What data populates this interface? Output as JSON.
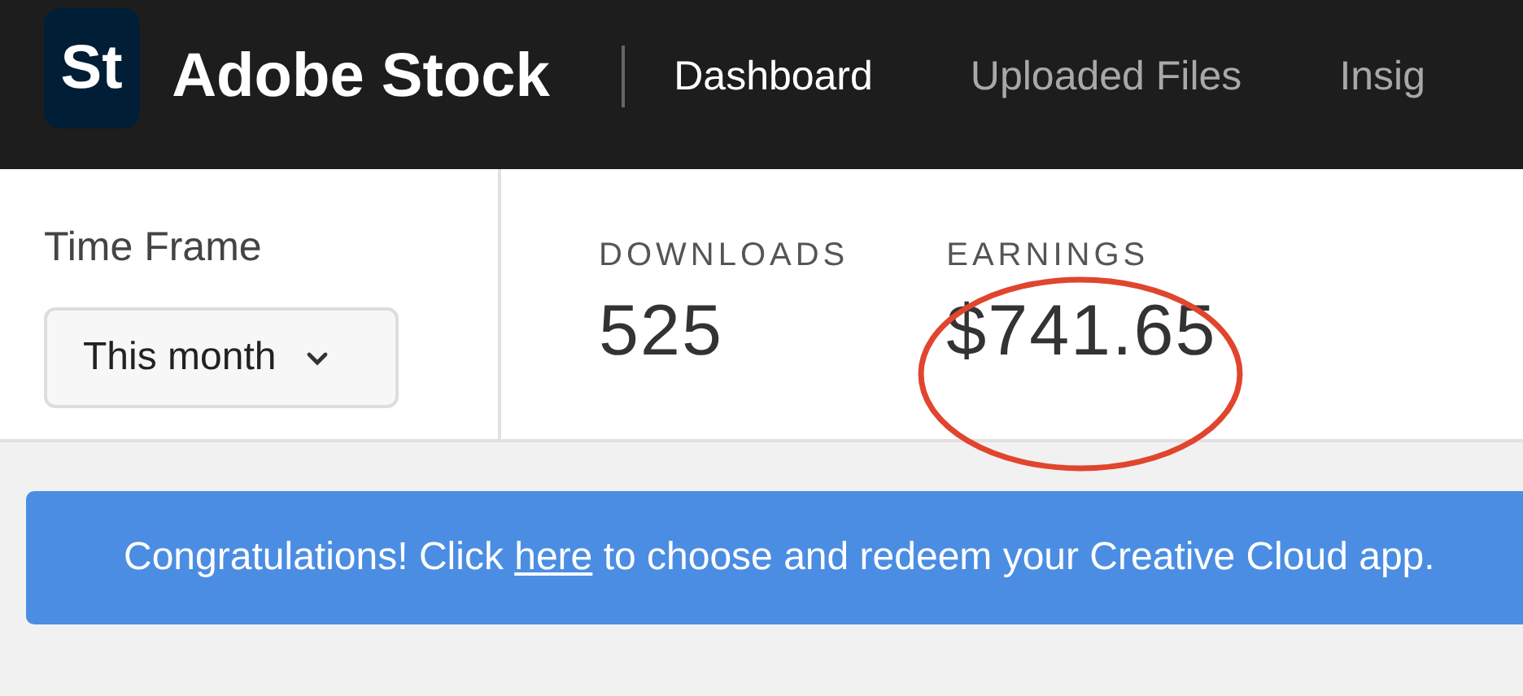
{
  "header": {
    "logo": "St",
    "brand": "Adobe Stock",
    "nav": [
      {
        "label": "Dashboard",
        "selected": true
      },
      {
        "label": "Uploaded Files",
        "selected": false
      },
      {
        "label": "Insig",
        "selected": false
      }
    ]
  },
  "time_frame": {
    "label": "Time Frame",
    "value": "This month"
  },
  "stats": [
    {
      "label": "DOWNLOADS",
      "value": "525",
      "circled": false
    },
    {
      "label": "EARNINGS",
      "value": "$741.65",
      "circled": true
    }
  ],
  "banner": {
    "before": "Congratulations! Click",
    "link": "here",
    "after": "to choose and redeem your Creative Cloud app."
  }
}
